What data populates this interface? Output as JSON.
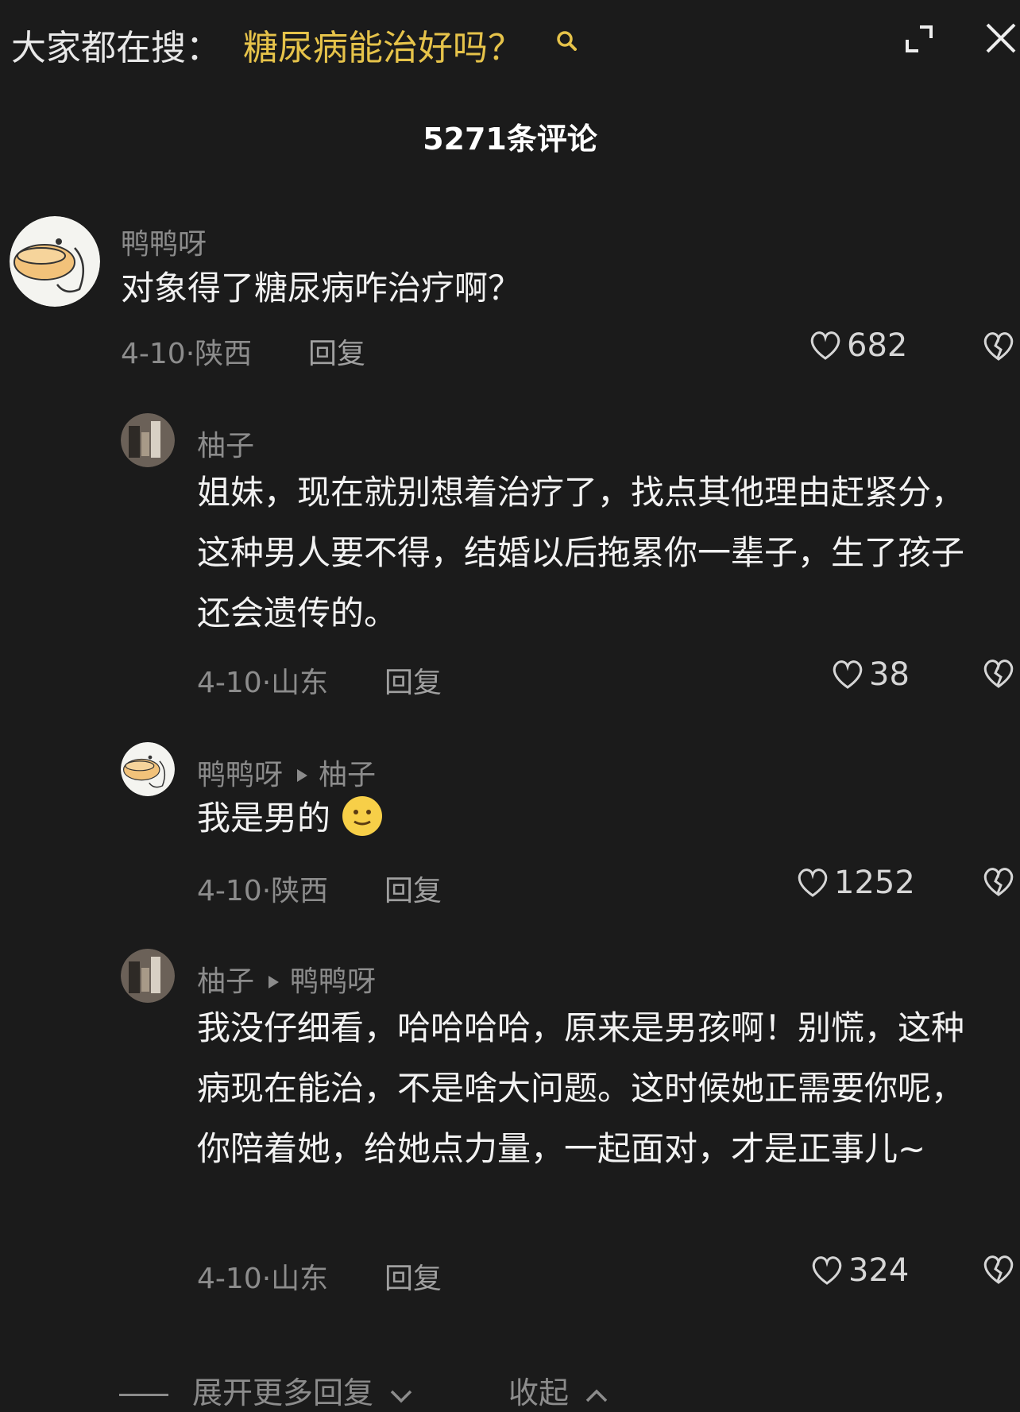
{
  "header": {
    "search_prefix": "大家都在搜：",
    "search_query": "糖尿病能治好吗？",
    "comment_count": "5271条评论"
  },
  "comments": [
    {
      "username": "鸭鸭呀",
      "text": "对象得了糖尿病咋治疗啊？",
      "meta": "4-10·陕西",
      "reply_label": "回复",
      "likes": "682"
    },
    {
      "username": "柚子",
      "text": "姐妹，现在就别想着治疗了，找点其他理由赶紧分，这种男人要不得，结婚以后拖累你一辈子，生了孩子还会遗传的。",
      "meta": "4-10·山东",
      "reply_label": "回复",
      "likes": "38"
    },
    {
      "username": "鸭鸭呀",
      "reply_to": "柚子",
      "text": "我是男的",
      "emoji": "slightly-smiling-face",
      "meta": "4-10·陕西",
      "reply_label": "回复",
      "likes": "1252"
    },
    {
      "username": "柚子",
      "reply_to": "鸭鸭呀",
      "text": "我没仔细看，哈哈哈哈，原来是男孩啊！别慌，这种病现在能治，不是啥大问题。这时候她正需要你呢，你陪着她，给她点力量，一起面对，才是正事儿~",
      "meta": "4-10·山东",
      "reply_label": "回复",
      "likes": "324"
    }
  ],
  "footer": {
    "expand_label": "展开更多回复",
    "collapse_label": "收起"
  },
  "colors": {
    "background": "#1b1b1b",
    "search_highlight": "#e6c34a",
    "secondary_text": "#8c8c8c"
  },
  "icons": [
    "search-icon",
    "expand-icon",
    "close-icon",
    "heart-icon",
    "broken-heart-icon",
    "chevron-down-icon",
    "chevron-up-icon"
  ]
}
